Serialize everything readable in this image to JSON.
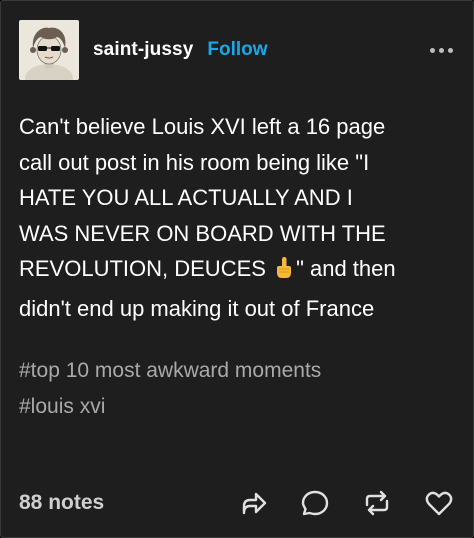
{
  "post": {
    "author": {
      "username": "saint-jussy",
      "follow_label": "Follow",
      "avatar_icon": "avatar-portrait"
    },
    "more_icon": "more-options-icon",
    "body_lines": [
      "Can't believe Louis XVI left a 16 page",
      "call out post in his room being like \"I",
      "HATE YOU ALL ACTUALLY AND I",
      "WAS NEVER ON BOARD WITH THE",
      "REVOLUTION, DEUCES",
      "\" and then",
      "didn't end up making it out of France"
    ],
    "emoji": "middle-finger-emoji",
    "tags": [
      "#top 10 most awkward moments",
      "#louis xvi"
    ],
    "notes_label": "88 notes",
    "actions": [
      "share-icon",
      "reply-icon",
      "reblog-icon",
      "like-icon"
    ],
    "colors": {
      "background": "#1e1e1e",
      "text": "#ffffff",
      "follow": "#19a8e8",
      "tags": "#a9a9a9",
      "notes": "#cfcfcf"
    }
  }
}
